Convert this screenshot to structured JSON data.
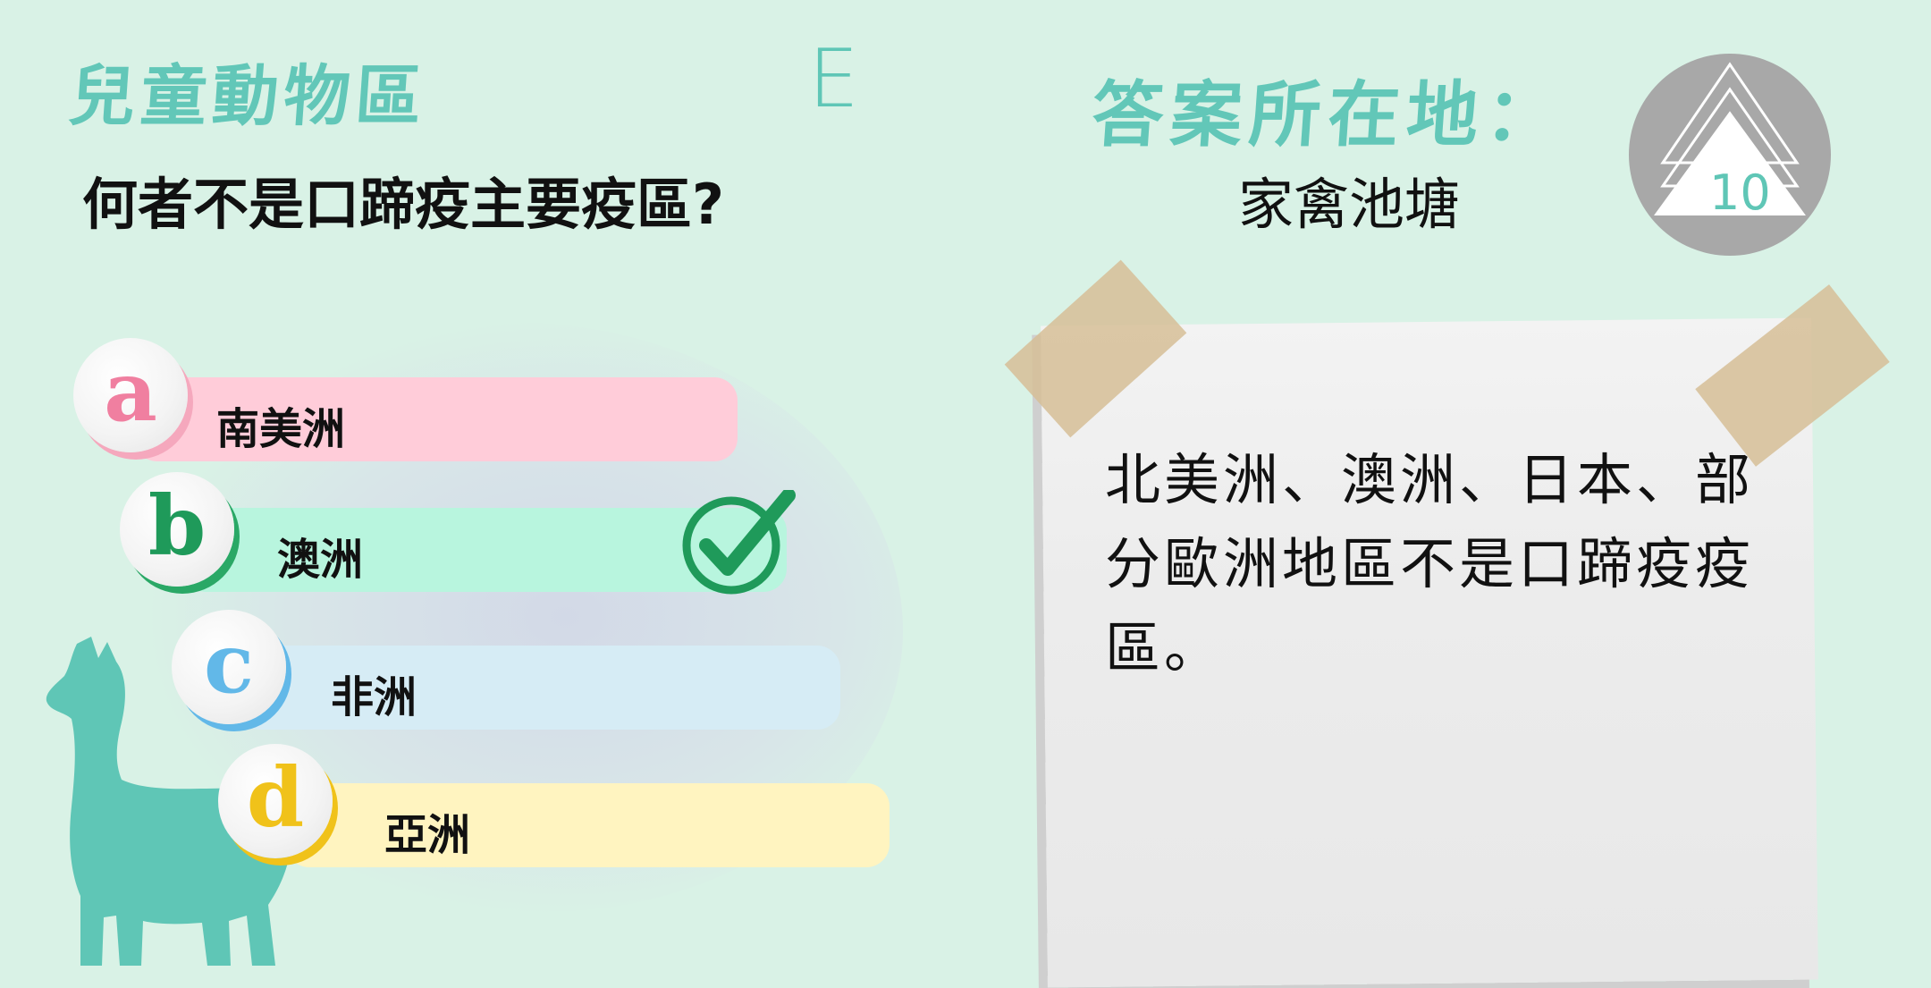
{
  "header": {
    "zone_title": "兒童動物區",
    "stage_letter": "E",
    "question": "何者不是口蹄疫主要疫區?",
    "answer_location_label": "答案所在地：",
    "answer_location_value": "家禽池塘"
  },
  "badge": {
    "number": "10",
    "icon": "triangle-tree-icon"
  },
  "options": [
    {
      "letter": "a",
      "label": "南美洲",
      "bar_color": "#ffccd9",
      "letter_color": "#f07fa0",
      "ring_color": "#f5a8bd",
      "correct": false
    },
    {
      "letter": "b",
      "label": "澳洲",
      "bar_color": "#b8f5de",
      "letter_color": "#1f9a5a",
      "ring_color": "#2aa866",
      "correct": true
    },
    {
      "letter": "c",
      "label": "非洲",
      "bar_color": "#d6ecf5",
      "letter_color": "#62b8e8",
      "ring_color": "#62b8e8",
      "correct": false
    },
    {
      "letter": "d",
      "label": "亞洲",
      "bar_color": "#fff4c0",
      "letter_color": "#f0c21a",
      "ring_color": "#f0c21a",
      "correct": false
    }
  ],
  "note": {
    "text": "北美洲、澳洲、日本、部分歐洲地區不是口蹄疫疫區。"
  },
  "colors": {
    "background": "#d9f2e6",
    "accent_teal": "#5fc6b6",
    "check_green": "#1f9a5a"
  }
}
